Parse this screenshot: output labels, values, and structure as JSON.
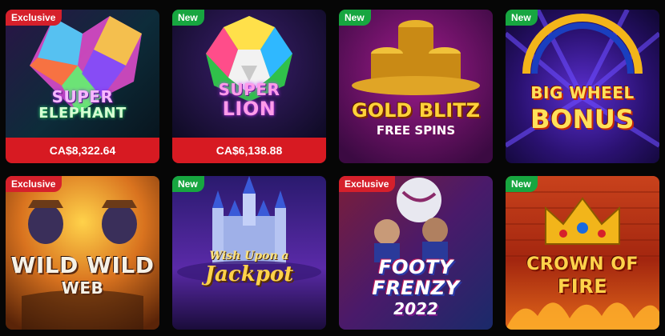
{
  "games": [
    {
      "title_line1": "SUPER",
      "title_line2": "ELEPHANT",
      "badge": "Exclusive",
      "jackpot": "CA$8,322.64"
    },
    {
      "title_line1": "SUPER",
      "title_line2": "LION",
      "badge": "New",
      "jackpot": "CA$6,138.88"
    },
    {
      "title_line1": "GOLD BLITZ",
      "title_line2": "FREE SPINS",
      "badge": "New"
    },
    {
      "title_line1": "BIG WHEEL",
      "title_line2": "BONUS",
      "badge": "New"
    },
    {
      "title_line1": "WILD WILD",
      "title_line2": "WEB",
      "badge": "Exclusive"
    },
    {
      "title_line1": "Wish Upon a",
      "title_line2": "Jackpot",
      "badge": "New"
    },
    {
      "title_line1": "FOOTY",
      "title_line2": "FRENZY",
      "title_line3": "2022",
      "badge": "Exclusive"
    },
    {
      "title_line1": "CROWN OF",
      "title_line2": "FIRE",
      "badge": "New"
    }
  ],
  "colors": {
    "exclusive": "#d6202b",
    "new": "#17a640",
    "jackpot_bar": "#d71a22"
  }
}
